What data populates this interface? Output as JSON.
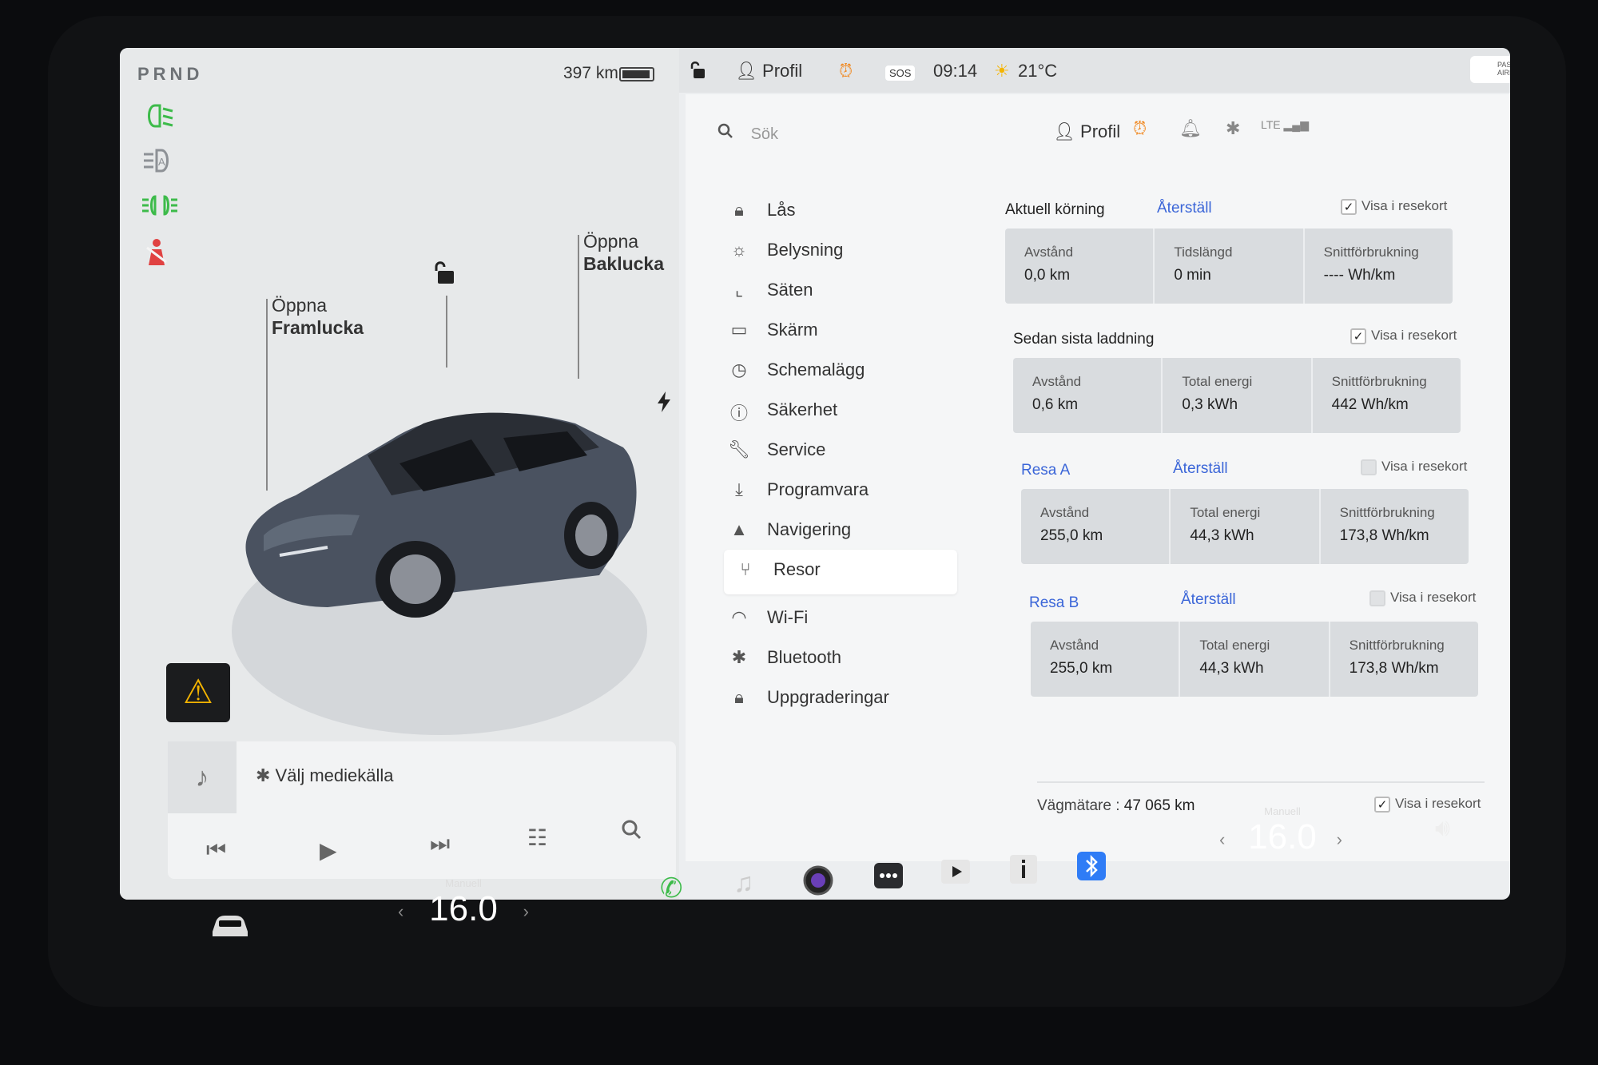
{
  "drive": {
    "gears": "PRND",
    "range": "397 km"
  },
  "car_panel": {
    "open_front": "Öppna\nFramlucka",
    "open_front_l1": "Öppna",
    "open_front_l2": "Framlucka",
    "open_rear_l1": "Öppna",
    "open_rear_l2": "Baklucka"
  },
  "media": {
    "source_label": "Välj mediekälla"
  },
  "status_bar": {
    "profile": "Profil",
    "sos": "SOS",
    "time": "09:14",
    "temperature": "21°C",
    "airbag": "PASSENGER AIRBAG"
  },
  "settings": {
    "search_placeholder": "Sök",
    "profile": "Profil",
    "menu": [
      {
        "label": "Lås",
        "icon": "lock-icon"
      },
      {
        "label": "Belysning",
        "icon": "light-icon"
      },
      {
        "label": "Säten",
        "icon": "seat-icon"
      },
      {
        "label": "Skärm",
        "icon": "display-icon"
      },
      {
        "label": "Schemalägg",
        "icon": "clock-icon"
      },
      {
        "label": "Säkerhet",
        "icon": "safety-icon"
      },
      {
        "label": "Service",
        "icon": "wrench-icon"
      },
      {
        "label": "Programvara",
        "icon": "download-icon"
      },
      {
        "label": "Navigering",
        "icon": "navigation-icon"
      },
      {
        "label": "Resor",
        "icon": "trips-icon",
        "active": true
      },
      {
        "label": "Wi-Fi",
        "icon": "wifi-icon"
      },
      {
        "label": "Bluetooth",
        "icon": "bluetooth-icon"
      },
      {
        "label": "Uppgraderingar",
        "icon": "upgrade-icon"
      }
    ],
    "current_drive": {
      "title": "Aktuell körning",
      "reset": "Återställ",
      "show": "Visa i resekort",
      "checked": true,
      "cells": [
        {
          "label": "Avstånd",
          "value": "0,0 km"
        },
        {
          "label": "Tidslängd",
          "value": "0 min"
        },
        {
          "label": "Snittförbrukning",
          "value": "---- Wh/km"
        }
      ]
    },
    "since_charge": {
      "title": "Sedan sista laddning",
      "show": "Visa i resekort",
      "checked": true,
      "cells": [
        {
          "label": "Avstånd",
          "value": "0,6 km"
        },
        {
          "label": "Total energi",
          "value": "0,3 kWh"
        },
        {
          "label": "Snittförbrukning",
          "value": "442 Wh/km"
        }
      ]
    },
    "trip_a": {
      "title": "Resa A",
      "reset": "Återställ",
      "show": "Visa i resekort",
      "checked": false,
      "cells": [
        {
          "label": "Avstånd",
          "value": "255,0 km"
        },
        {
          "label": "Total energi",
          "value": "44,3 kWh"
        },
        {
          "label": "Snittförbrukning",
          "value": "173,8 Wh/km"
        }
      ]
    },
    "trip_b": {
      "title": "Resa B",
      "reset": "Återställ",
      "show": "Visa i resekort",
      "checked": false,
      "cells": [
        {
          "label": "Avstånd",
          "value": "255,0 km"
        },
        {
          "label": "Total energi",
          "value": "44,3 kWh"
        },
        {
          "label": "Snittförbrukning",
          "value": "173,8 Wh/km"
        }
      ]
    },
    "odometer": {
      "label": "Vägmätare :",
      "value": "47 065 km",
      "show": "Visa i resekort",
      "checked": true
    }
  },
  "climate": {
    "driver_label": "Manuell",
    "driver_temp": "16.0",
    "passenger_label": "Manuell",
    "passenger_temp": "16.0"
  },
  "colors": {
    "accent_blue": "#3b66d8",
    "indicator_green": "#3dbb4a",
    "warning_yellow": "#f4b400",
    "seatbelt_red": "#e04242"
  }
}
